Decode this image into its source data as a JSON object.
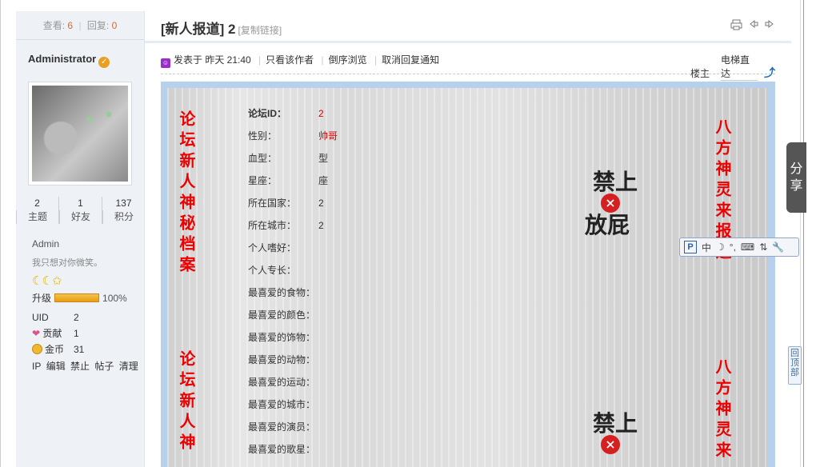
{
  "thread": {
    "views_label": "查看:",
    "views": "6",
    "replies_label": "回复:",
    "replies": "0",
    "title": "[新人报道] 2",
    "copy_link": "[复制链接]"
  },
  "author": {
    "name": "Administrator",
    "verified_glyph": "✓",
    "stats": [
      {
        "value": "2",
        "label": "主题"
      },
      {
        "value": "1",
        "label": "好友"
      },
      {
        "value": "137",
        "label": "积分"
      }
    ],
    "role": "Admin",
    "signature": "我只想对你微笑。",
    "rank_icons": "☾☾✩",
    "level_label": "升级",
    "level_progress": 100,
    "level_percent": "100%",
    "uid_label": "UID",
    "uid": "2",
    "contrib_label": "贡献",
    "contrib": "1",
    "coins_label": "金币",
    "coins": "31",
    "admin_links": [
      "IP",
      "编辑",
      "禁止",
      "帖子",
      "清理"
    ]
  },
  "postbar": {
    "posted": "发表于 昨天 21:40",
    "only_author": "只看该作者",
    "reverse": "倒序浏览",
    "cancel_notify": "取消回复通知",
    "floor_label": "楼主",
    "jump_label": "电梯直达"
  },
  "poster": {
    "left_text_1": "论坛新人神秘档案",
    "left_text_2": "论坛新人神",
    "right_text_1": "八方神灵来报道",
    "right_text_2": "八方神灵来",
    "stamp_top": "禁上",
    "stamp_bottom": "放屁",
    "stamp_x": "×",
    "fields": [
      {
        "key": "论坛ID：",
        "value": "2",
        "bold": true,
        "red": true
      },
      {
        "key": "性别：",
        "value": "帅哥",
        "red": true
      },
      {
        "key": "血型：",
        "value": "型"
      },
      {
        "key": "星座：",
        "value": "座"
      },
      {
        "key": "所在国家：",
        "value": "2"
      },
      {
        "key": "所在城市：",
        "value": "2"
      },
      {
        "key": "个人嗜好：",
        "value": ""
      },
      {
        "key": "个人专长：",
        "value": ""
      },
      {
        "key": "最喜爱的食物：",
        "value": ""
      },
      {
        "key": "最喜爱的颜色：",
        "value": ""
      },
      {
        "key": "最喜爱的饰物：",
        "value": ""
      },
      {
        "key": "最喜爱的动物：",
        "value": ""
      },
      {
        "key": "最喜爱的运动：",
        "value": ""
      },
      {
        "key": "最喜爱的城市：",
        "value": ""
      },
      {
        "key": "最喜爱的演员：",
        "value": ""
      },
      {
        "key": "最喜爱的歌星：",
        "value": ""
      }
    ]
  },
  "overlays": {
    "share": "分享",
    "ime_p": "P",
    "ime_mode": "中",
    "ime_items": [
      "☽",
      "°,",
      "⌨",
      "⇅",
      "🔧"
    ],
    "back_top": "回顶部"
  }
}
